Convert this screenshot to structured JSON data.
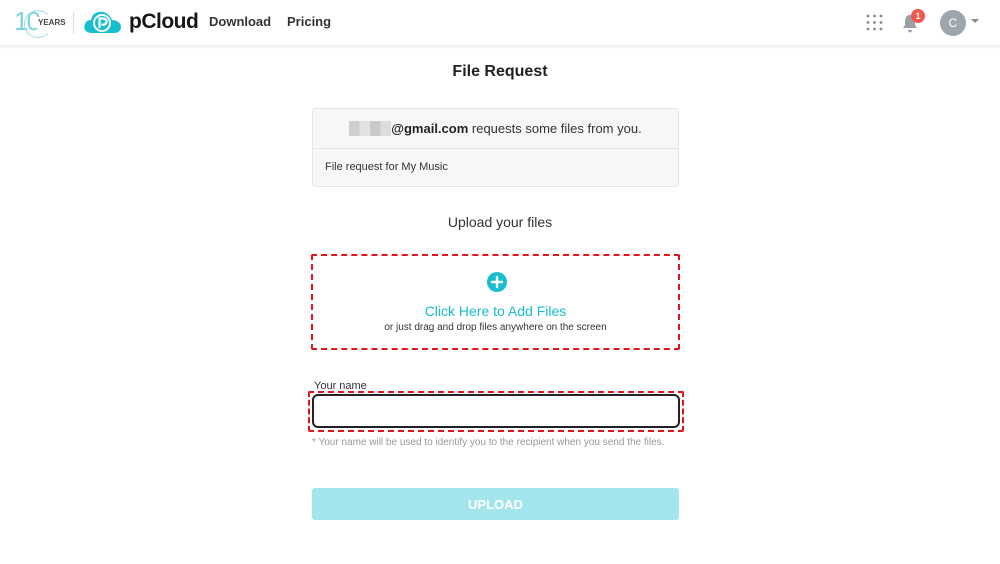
{
  "header": {
    "anniversary_number": "10",
    "anniversary_label": "YEARS",
    "logo_text": "pCloud",
    "nav": {
      "download": "Download",
      "pricing": "Pricing"
    },
    "notification_count": "1",
    "avatar_initial": "C"
  },
  "main": {
    "title": "File Request",
    "request": {
      "email_domain": "@gmail.com",
      "message": " requests some files from you.",
      "description": "File request for My Music"
    },
    "upload_heading": "Upload your files",
    "dropzone": {
      "label": "Click Here to Add Files",
      "hint": "or just drag and drop files anywhere on the screen"
    },
    "name_field": {
      "label": "Your name",
      "value": "",
      "note": "* Your name will be used to identify you to the recipient when you send the files."
    },
    "upload_button": "UPLOAD"
  },
  "colors": {
    "brand": "#17bed0",
    "button_disabled": "#a3e5ec",
    "highlight_dashed": "#e2151b",
    "notification": "#f2564e"
  },
  "icons": [
    "plus-icon",
    "apps-grid-icon",
    "bell-icon",
    "caret-down-icon",
    "pcloud-logo-icon"
  ]
}
